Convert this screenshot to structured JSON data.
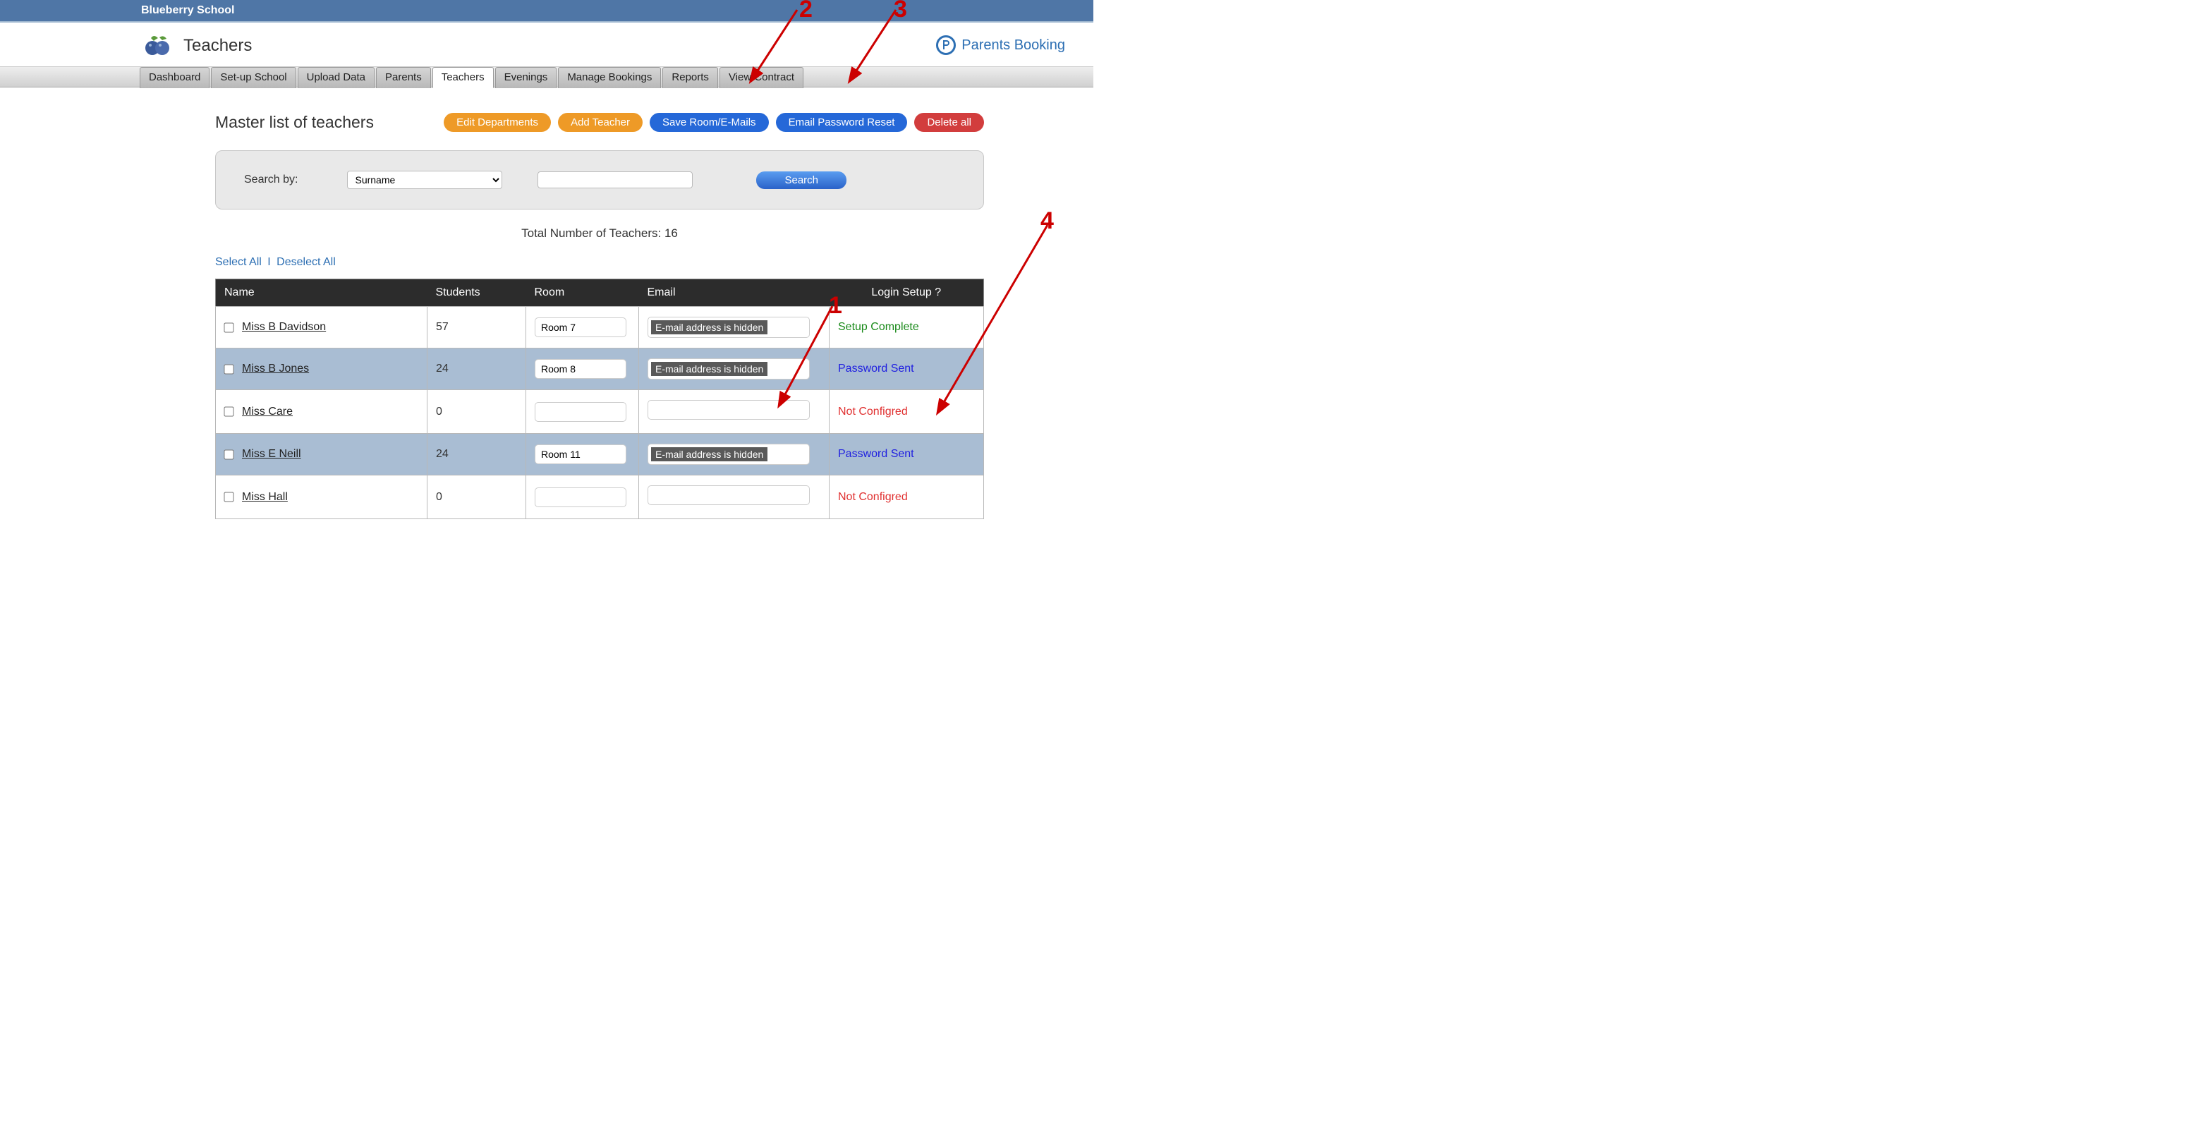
{
  "school_name": "Blueberry School",
  "page_title": "Teachers",
  "brand": "Parents Booking",
  "nav": {
    "items": [
      "Dashboard",
      "Set-up School",
      "Upload Data",
      "Parents",
      "Teachers",
      "Evenings",
      "Manage Bookings",
      "Reports",
      "View Contract"
    ],
    "active_index": 4
  },
  "section_title": "Master list of teachers",
  "action_buttons": {
    "edit_departments": "Edit Departments",
    "add_teacher": "Add Teacher",
    "save_room_emails": "Save Room/E-Mails",
    "email_password_reset": "Email Password Reset",
    "delete_all": "Delete all"
  },
  "search": {
    "label": "Search by:",
    "dropdown_selected": "Surname",
    "input_value": "",
    "button": "Search"
  },
  "total_label": "Total Number of Teachers: ",
  "total_count": "16",
  "select_links": {
    "select_all": "Select All",
    "deselect_all": "Deselect All",
    "sep": "I"
  },
  "columns": {
    "name": "Name",
    "students": "Students",
    "room": "Room",
    "email": "Email",
    "login": "Login Setup ?"
  },
  "email_hidden_text": "E-mail address is hidden",
  "rows": [
    {
      "name": "Miss B Davidson",
      "students": "57",
      "room": "Room 7",
      "email_hidden": true,
      "status_text": "Setup Complete",
      "status_class": "status-complete",
      "alt": false
    },
    {
      "name": "Miss B Jones",
      "students": "24",
      "room": "Room 8",
      "email_hidden": true,
      "status_text": "Password Sent",
      "status_class": "status-sent",
      "alt": true
    },
    {
      "name": "Miss Care",
      "students": "0",
      "room": "",
      "email_hidden": false,
      "status_text": "Not Configred",
      "status_class": "status-not",
      "alt": false
    },
    {
      "name": "Miss E Neill",
      "students": "24",
      "room": "Room 11",
      "email_hidden": true,
      "status_text": "Password Sent",
      "status_class": "status-sent",
      "alt": true
    },
    {
      "name": "Miss Hall",
      "students": "0",
      "room": "",
      "email_hidden": false,
      "status_text": "Not Configred",
      "status_class": "status-not",
      "alt": false
    }
  ],
  "annotations": {
    "n1": "1",
    "n2": "2",
    "n3": "3",
    "n4": "4"
  }
}
